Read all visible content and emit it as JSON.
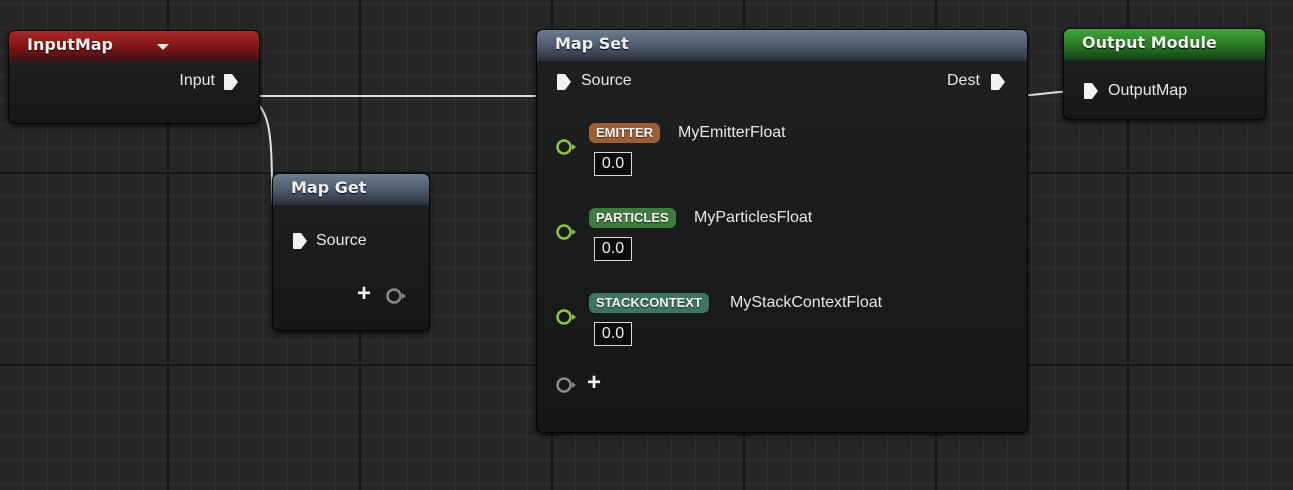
{
  "nodes": {
    "input_map": {
      "title": "InputMap",
      "output_pin": "Input"
    },
    "map_get": {
      "title": "Map Get",
      "input_pin": "Source",
      "add_pin_symbol": "+"
    },
    "map_set": {
      "title": "Map Set",
      "input_pin": "Source",
      "output_pin": "Dest",
      "params": [
        {
          "namespace": "EMITTER",
          "name": "MyEmitterFloat",
          "value": "0.0",
          "badge_color": "#9a5f34"
        },
        {
          "namespace": "PARTICLES",
          "name": "MyParticlesFloat",
          "value": "0.0",
          "badge_color": "#3f7a3e"
        },
        {
          "namespace": "STACKCONTEXT",
          "name": "MyStackContextFloat",
          "value": "0.0",
          "badge_color": "#3e7560"
        }
      ],
      "add_pin_symbol": "+"
    },
    "output_module": {
      "title": "Output Module",
      "input_pin": "OutputMap"
    }
  },
  "colors": {
    "input_map_header": "#8a1a1a",
    "map_node_header": "#56647a",
    "output_module_header": "#2f8c2b",
    "float_pin": "#8cc63f",
    "wire": "#e0e0e0"
  },
  "icons": {
    "exec_pin": "pentagon-arrow-pin-icon",
    "float_pin": "green-ring-pin-icon",
    "add_pin": "plus-icon",
    "empty_pin": "gray-ring-pin-icon",
    "dropdown": "chevron-down-icon"
  }
}
